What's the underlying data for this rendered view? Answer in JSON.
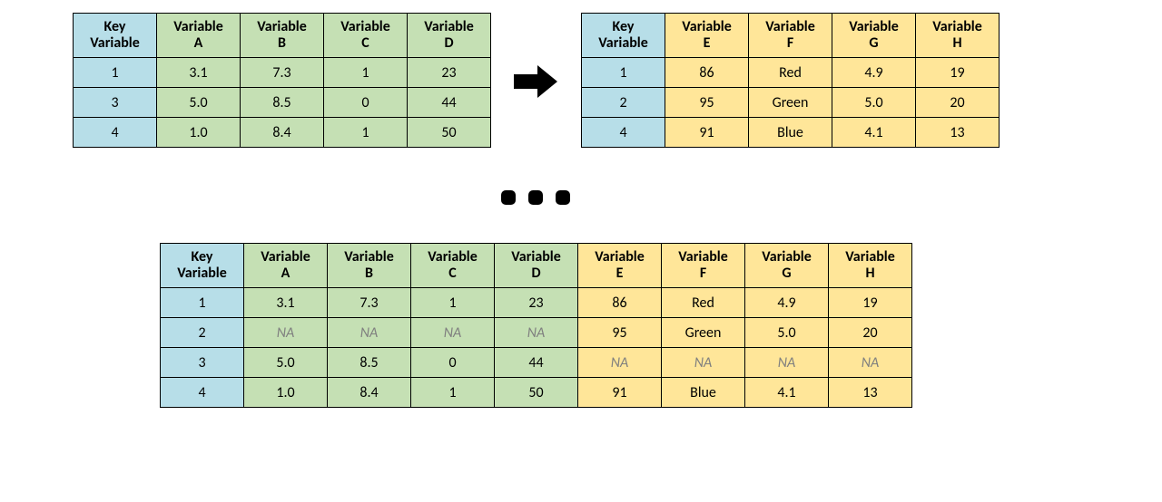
{
  "colors": {
    "key_bg": "#b7dee8",
    "green_bg": "#c5e0b4",
    "yellow_bg": "#ffe699",
    "na_text": "#7f7f7f",
    "border": "#000000"
  },
  "headers": {
    "key_line1": "Key",
    "key_line2": "Variable",
    "var_line1": "Variable",
    "A": "A",
    "B": "B",
    "C": "C",
    "D": "D",
    "E": "E",
    "F": "F",
    "G": "G",
    "H": "H"
  },
  "na_label": "NA",
  "left_table": {
    "keys": [
      "1",
      "3",
      "4"
    ],
    "rows": [
      {
        "A": "3.1",
        "B": "7.3",
        "C": "1",
        "D": "23"
      },
      {
        "A": "5.0",
        "B": "8.5",
        "C": "0",
        "D": "44"
      },
      {
        "A": "1.0",
        "B": "8.4",
        "C": "1",
        "D": "50"
      }
    ]
  },
  "right_table": {
    "keys": [
      "1",
      "2",
      "4"
    ],
    "rows": [
      {
        "E": "86",
        "F": "Red",
        "G": "4.9",
        "H": "19"
      },
      {
        "E": "95",
        "F": "Green",
        "G": "5.0",
        "H": "20"
      },
      {
        "E": "91",
        "F": "Blue",
        "G": "4.1",
        "H": "13"
      }
    ]
  },
  "merged_table": {
    "keys": [
      "1",
      "2",
      "3",
      "4"
    ],
    "rows": [
      {
        "A": "3.1",
        "B": "7.3",
        "C": "1",
        "D": "23",
        "E": "86",
        "F": "Red",
        "G": "4.9",
        "H": "19"
      },
      {
        "A": null,
        "B": null,
        "C": null,
        "D": null,
        "E": "95",
        "F": "Green",
        "G": "5.0",
        "H": "20"
      },
      {
        "A": "5.0",
        "B": "8.5",
        "C": "0",
        "D": "44",
        "E": null,
        "F": null,
        "G": null,
        "H": null
      },
      {
        "A": "1.0",
        "B": "8.4",
        "C": "1",
        "D": "50",
        "E": "91",
        "F": "Blue",
        "G": "4.1",
        "H": "13"
      }
    ]
  }
}
